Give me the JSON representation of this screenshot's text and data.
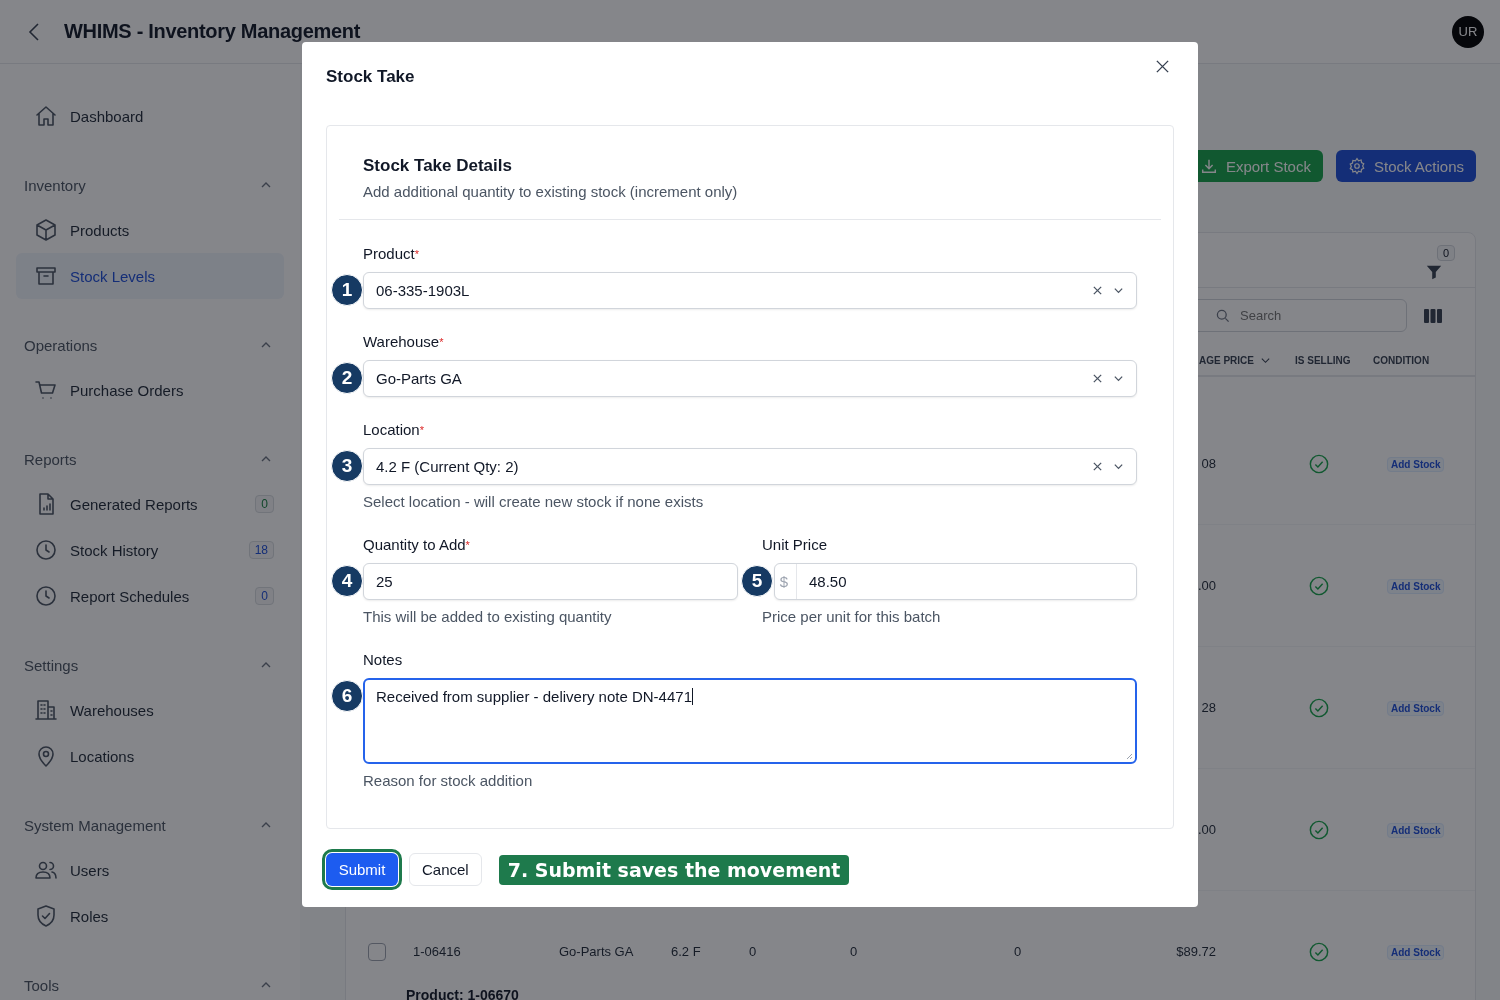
{
  "app": {
    "title": "WHIMS - Inventory Management",
    "avatar": "UR"
  },
  "sidebar": {
    "top_items": [
      {
        "label": "Dashboard",
        "selected": false
      }
    ],
    "sections": [
      {
        "title": "Inventory",
        "expanded": true,
        "items": [
          {
            "label": "Products",
            "selected": false
          },
          {
            "label": "Stock Levels",
            "selected": true
          }
        ]
      },
      {
        "title": "Operations",
        "expanded": true,
        "items": [
          {
            "label": "Purchase Orders",
            "selected": false
          }
        ]
      },
      {
        "title": "Reports",
        "expanded": true,
        "items": [
          {
            "label": "Generated Reports",
            "selected": false,
            "badge": "0",
            "color": "#10472a"
          },
          {
            "label": "Stock History",
            "selected": false,
            "badge": "18",
            "color": "#142e77"
          },
          {
            "label": "Report Schedules",
            "selected": false,
            "badge": "0",
            "color": "#142e77"
          }
        ]
      },
      {
        "title": "Settings",
        "expanded": true,
        "items": [
          {
            "label": "Warehouses",
            "selected": false
          },
          {
            "label": "Locations",
            "selected": false
          }
        ]
      },
      {
        "title": "System Management",
        "expanded": true,
        "items": [
          {
            "label": "Users",
            "selected": false
          },
          {
            "label": "Roles",
            "selected": false
          }
        ]
      },
      {
        "title": "Tools",
        "expanded": true
      }
    ]
  },
  "toolbar": {
    "buttons": [
      {
        "kind": "export",
        "label": "Export Stock"
      },
      {
        "kind": "actions",
        "label": "Stock Actions"
      }
    ]
  },
  "table": {
    "filter_count": "0",
    "search": {
      "placeholder": "Search"
    },
    "columns": [
      {
        "label": "AGE PRICE",
        "sortable": true
      },
      {
        "label": "IS SELLING",
        "sortable": false
      },
      {
        "label": "CONDITION",
        "sortable": false
      }
    ],
    "rows": [
      {
        "price": "08",
        "is_selling": true,
        "condition": "Add Stock"
      },
      {
        "price": ".00",
        "is_selling": true,
        "condition": "Add Stock"
      },
      {
        "price": "28",
        "is_selling": true,
        "condition": "Add Stock"
      },
      {
        "price": ".00",
        "is_selling": true,
        "condition": "Add Stock"
      },
      {
        "checked": false,
        "column_1": "1-06416",
        "column_2": "Go-Parts GA",
        "column_3": "6.2 F",
        "column_4": "0",
        "column_5": "0",
        "column_6": "0",
        "price": "$89.72",
        "is_selling": true,
        "condition": "Add Stock"
      }
    ],
    "group_header": "Product: 1-06670"
  },
  "dialog": {
    "title": "Stock Take",
    "card_title": "Stock Take Details",
    "card_subtitle": "Add additional quantity to existing stock (increment only)",
    "required_mark": "*",
    "fields": [
      {
        "kind": "select",
        "label": "Product",
        "required": true,
        "value": "06-335-1903L",
        "step": "1"
      },
      {
        "kind": "select",
        "label": "Warehouse",
        "required": true,
        "value": "Go-Parts GA",
        "step": "2"
      },
      {
        "kind": "select",
        "label": "Location",
        "required": true,
        "value": "4.2 F (Current Qty: 2)",
        "step": "3",
        "help": "Select location - will create new stock if none exists"
      },
      {
        "kind": "pair",
        "fields": [
          {
            "kind": "number",
            "label": "Quantity to Add",
            "required": true,
            "value": "25",
            "step": "4",
            "help": "This will be added to existing quantity"
          },
          {
            "kind": "currency",
            "label": "Unit Price",
            "required": false,
            "prefix": "$",
            "value": "48.50",
            "step": "5",
            "help": "Price per unit for this batch"
          }
        ]
      },
      {
        "kind": "textarea",
        "label": "Notes",
        "required": false,
        "value": "Received from supplier - delivery note DN-4471",
        "focused": true,
        "step": "6",
        "help": "Reason for stock addition"
      }
    ],
    "buttons": [
      {
        "kind": "primary",
        "label": "Submit",
        "highlighted": true
      },
      {
        "kind": "secondary",
        "label": "Cancel",
        "highlighted": false
      }
    ],
    "callout": "7. Submit saves the movement"
  }
}
